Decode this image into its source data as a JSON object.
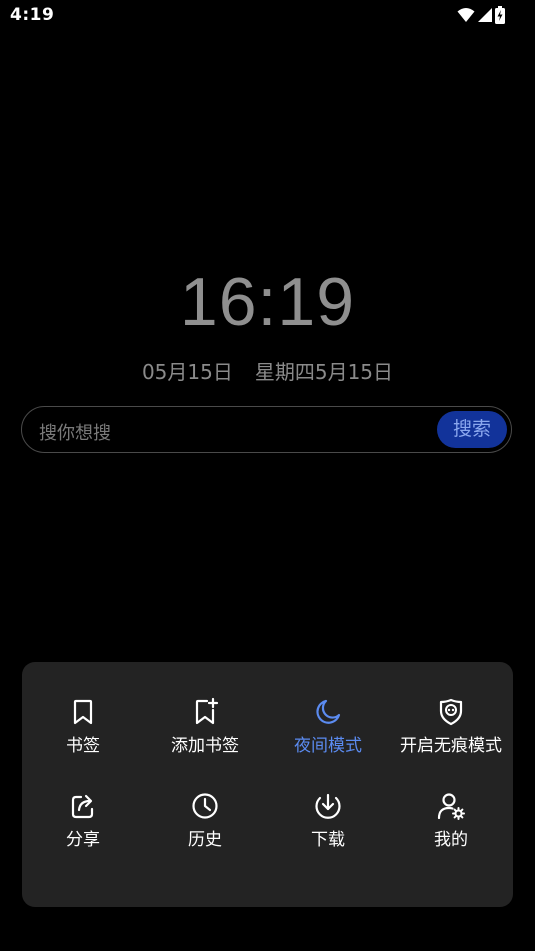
{
  "status_bar": {
    "time": "4:19",
    "icons": [
      "wifi-icon",
      "signal-icon",
      "battery-charging-icon"
    ]
  },
  "clock": {
    "time": "16:19",
    "date": "05月15日",
    "weekday_date": "星期四5月15日"
  },
  "search": {
    "placeholder": "搜你想搜",
    "button_label": "搜索"
  },
  "menu": {
    "items": [
      {
        "label": "书签",
        "icon": "bookmark-icon"
      },
      {
        "label": "添加书签",
        "icon": "add-bookmark-icon"
      },
      {
        "label": "夜间模式",
        "icon": "moon-icon",
        "active": true
      },
      {
        "label": "开启无痕模式",
        "icon": "incognito-ghost-icon"
      },
      {
        "label": "分享",
        "icon": "share-icon"
      },
      {
        "label": "历史",
        "icon": "history-clock-icon"
      },
      {
        "label": "下载",
        "icon": "download-icon"
      },
      {
        "label": "我的",
        "icon": "user-settings-icon"
      }
    ]
  },
  "colors": {
    "background": "#000000",
    "panel": "#232323",
    "accent": "#5b8bf0",
    "search_button": "#12339a"
  }
}
